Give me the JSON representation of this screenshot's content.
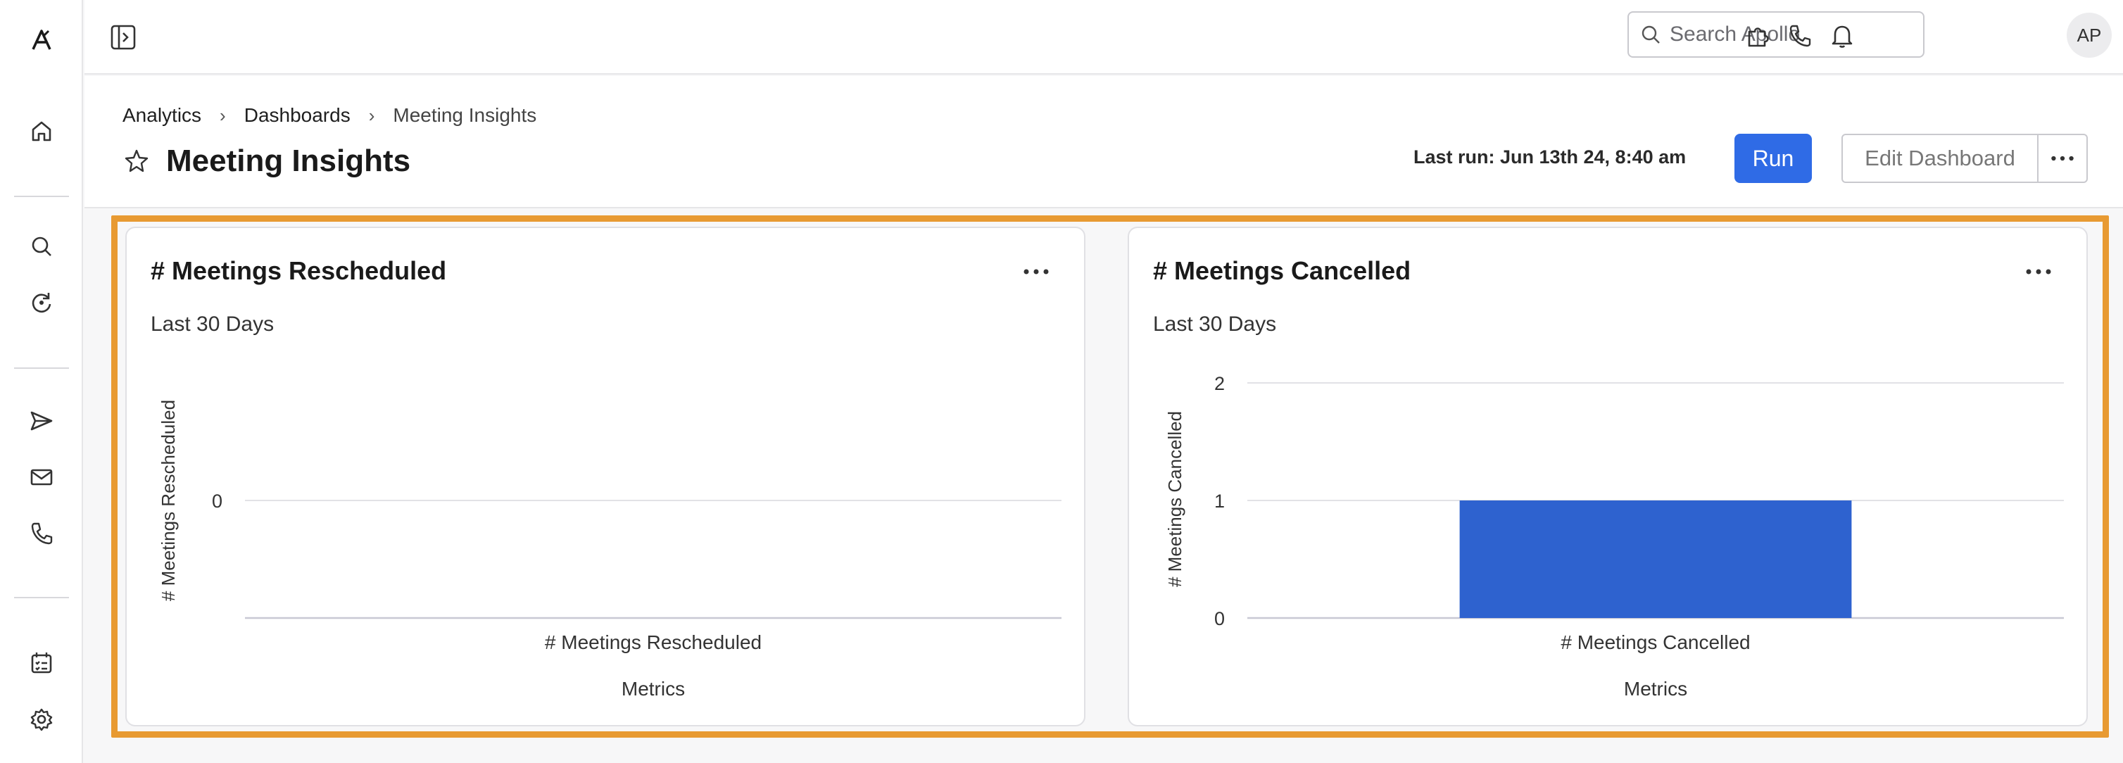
{
  "topbar": {
    "search_placeholder": "Search Apollo",
    "avatar_initials": "AP"
  },
  "breadcrumb": [
    "Analytics",
    "Dashboards",
    "Meeting Insights"
  ],
  "header": {
    "title": "Meeting Insights",
    "last_run": "Last run: Jun 13th 24, 8:40 am",
    "run_label": "Run",
    "edit_label": "Edit Dashboard"
  },
  "colors": {
    "accent": "#2f6be6",
    "bar": "#2e62cf",
    "highlight": "#e89a32"
  },
  "cards": [
    {
      "title": "# Meetings Rescheduled",
      "subtitle": "Last 30 Days"
    },
    {
      "title": "# Meetings Cancelled",
      "subtitle": "Last 30 Days"
    }
  ],
  "chart_data": [
    {
      "type": "bar",
      "categories": [
        "# Meetings Rescheduled"
      ],
      "values": [
        0
      ],
      "xlabel": "Metrics",
      "ylabel": "# Meetings Rescheduled",
      "yticks": [
        "0"
      ],
      "grid": true
    },
    {
      "type": "bar",
      "categories": [
        "# Meetings Cancelled"
      ],
      "values": [
        1
      ],
      "xlabel": "Metrics",
      "ylabel": "# Meetings Cancelled",
      "ylim": [
        0,
        2
      ],
      "yticks": [
        "0",
        "1",
        "2"
      ],
      "grid": true
    }
  ]
}
